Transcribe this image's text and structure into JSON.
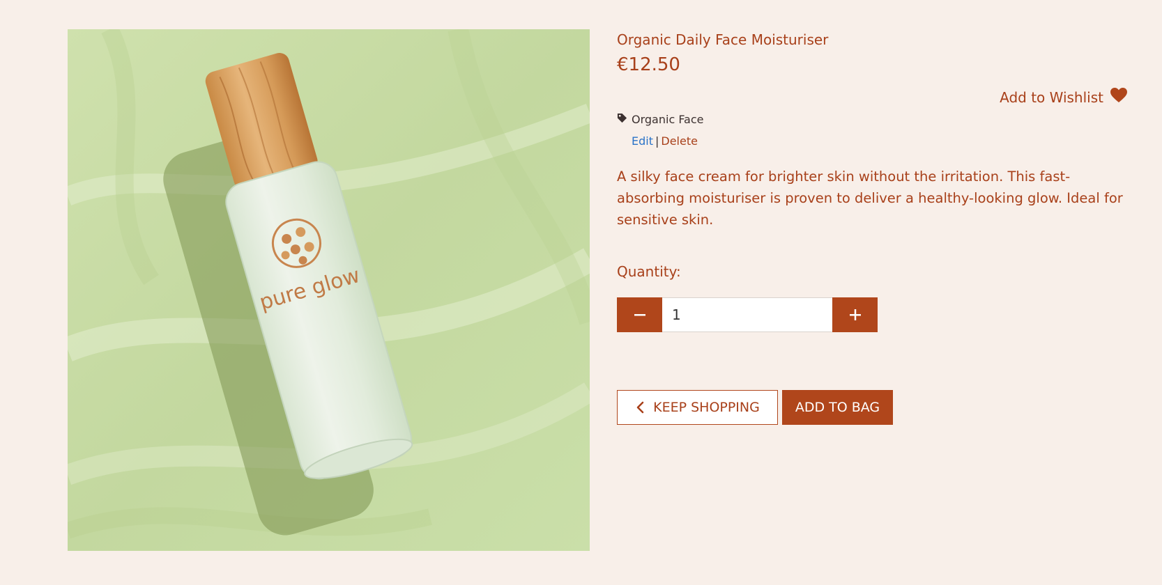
{
  "product": {
    "title": "Organic Daily Face Moisturiser",
    "price": "€12.50",
    "brand_on_bottle": "pure glow",
    "wishlist_label": "Add to Wishlist",
    "category": "Organic Face",
    "admin": {
      "edit_label": "Edit",
      "separator": "|",
      "delete_label": "Delete"
    },
    "description": "A silky face cream for brighter skin without the irritation. This fast-absorbing moisturiser is proven to deliver a healthy-looking glow. Ideal for sensitive skin."
  },
  "quantity": {
    "label": "Quantity:",
    "value": "1"
  },
  "actions": {
    "keep_shopping_label": "KEEP SHOPPING",
    "add_to_bag_label": "ADD TO BAG"
  },
  "icons": {
    "wishlist": "heart-icon",
    "category": "tag-icon",
    "decrement": "minus-icon",
    "increment": "plus-icon",
    "back": "chevron-left-icon"
  },
  "colors": {
    "background": "#f8efe9",
    "accent": "#b0461b",
    "text": "#a8401a",
    "link": "#2a73c8",
    "image_background": "#c9dca7"
  }
}
